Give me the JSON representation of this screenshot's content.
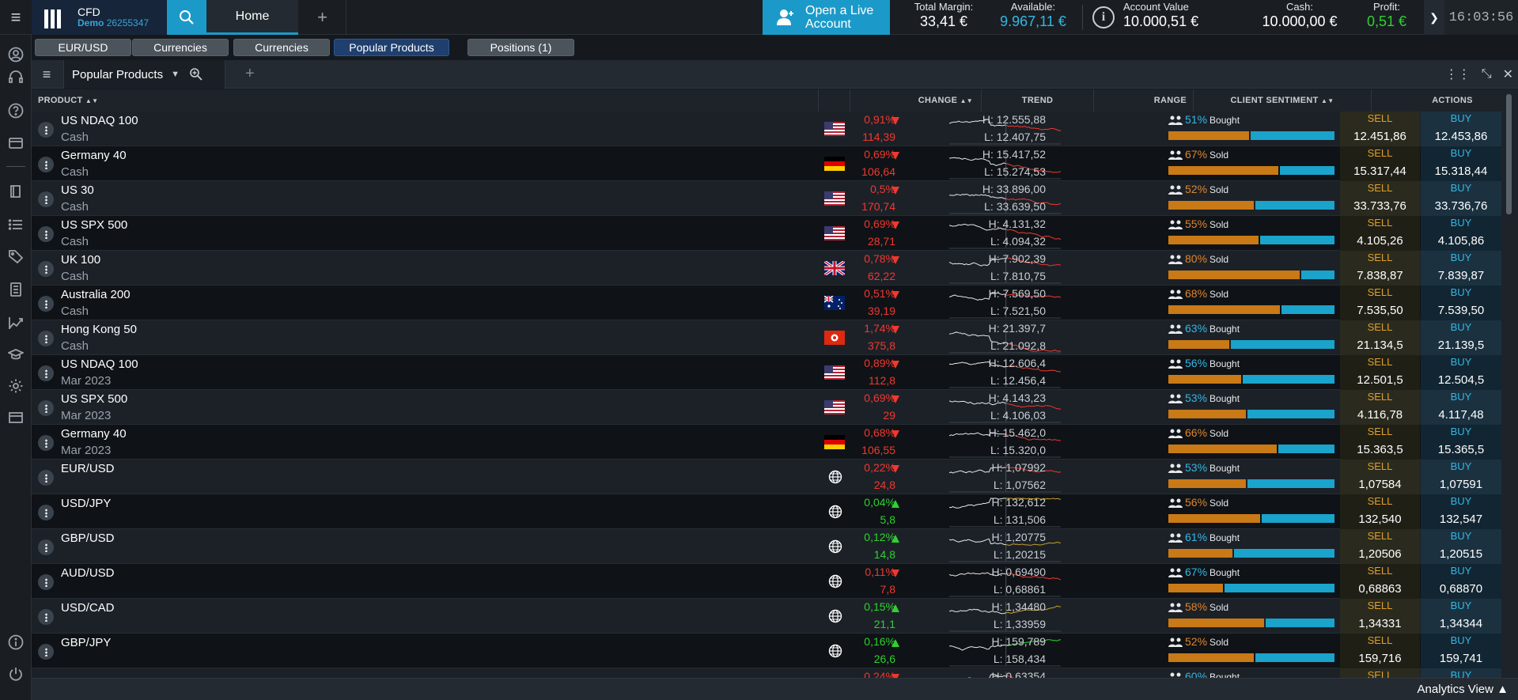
{
  "app": {
    "brand_title": "CFD",
    "brand_sub_prefix": "Demo",
    "brand_sub_account": "26255347",
    "home_tab": "Home",
    "add_tab": "+"
  },
  "header": {
    "live_account_line1": "Open a Live",
    "live_account_line2": "Account",
    "total_margin_label": "Total Margin:",
    "total_margin_value": "33,41 €",
    "available_label": "Available:",
    "available_value": "9.967,11 €",
    "account_value_label": "Account Value",
    "account_value_value": "10.000,51 €",
    "cash_label": "Cash:",
    "cash_value": "10.000,00 €",
    "profit_label": "Profit:",
    "profit_value": "0,51 €",
    "clock": "16:03:56"
  },
  "workspace_tabs": [
    {
      "label": "EUR/USD",
      "active": false
    },
    {
      "label": "Currencies",
      "active": false
    },
    {
      "label": "Currencies",
      "active": false
    },
    {
      "label": "Popular Products",
      "active": true
    },
    {
      "label": "Positions (1)",
      "active": false
    }
  ],
  "panel": {
    "title": "Popular Products"
  },
  "table": {
    "columns": {
      "product": "PRODUCT",
      "change": "CHANGE",
      "trend": "TREND",
      "range": "RANGE",
      "sentiment": "CLIENT SENTIMENT",
      "actions": "ACTIONS"
    },
    "sell_label": "SELL",
    "buy_label": "BUY",
    "rows": [
      {
        "name": "US NDAQ 100",
        "sub": "Cash",
        "flag": "us",
        "dir": "down",
        "pct": "0,91%",
        "abs": "114,39",
        "high": "H: 12.555,88",
        "low": "L: 12.407,75",
        "sent_pct": "51%",
        "sent_label": "Bought",
        "sold_share": 49,
        "sell": "12.451,86",
        "buy": "12.453,86",
        "trend_color": "red"
      },
      {
        "name": "Germany 40",
        "sub": "Cash",
        "flag": "de",
        "dir": "down",
        "pct": "0,69%",
        "abs": "106,64",
        "high": "H: 15.417,52",
        "low": "L: 15.274,53",
        "sent_pct": "67%",
        "sent_label": "Sold",
        "sold_share": 67,
        "sell": "15.317,44",
        "buy": "15.318,44",
        "trend_color": "red"
      },
      {
        "name": "US 30",
        "sub": "Cash",
        "flag": "us",
        "dir": "down",
        "pct": "0,5%",
        "abs": "170,74",
        "high": "H: 33.896,00",
        "low": "L: 33.639,50",
        "sent_pct": "52%",
        "sent_label": "Sold",
        "sold_share": 52,
        "sell": "33.733,76",
        "buy": "33.736,76",
        "trend_color": "red"
      },
      {
        "name": "US SPX 500",
        "sub": "Cash",
        "flag": "us",
        "dir": "down",
        "pct": "0,69%",
        "abs": "28,71",
        "high": "H: 4.131,32",
        "low": "L: 4.094,32",
        "sent_pct": "55%",
        "sent_label": "Sold",
        "sold_share": 55,
        "sell": "4.105,26",
        "buy": "4.105,86",
        "trend_color": "red"
      },
      {
        "name": "UK 100",
        "sub": "Cash",
        "flag": "gb",
        "dir": "down",
        "pct": "0,78%",
        "abs": "62,22",
        "high": "H: 7.902,39",
        "low": "L: 7.810,75",
        "sent_pct": "80%",
        "sent_label": "Sold",
        "sold_share": 80,
        "sell": "7.838,87",
        "buy": "7.839,87",
        "trend_color": "red"
      },
      {
        "name": "Australia 200",
        "sub": "Cash",
        "flag": "au",
        "dir": "down",
        "pct": "0,51%",
        "abs": "39,19",
        "high": "H: 7.569,50",
        "low": "L: 7.521,50",
        "sent_pct": "68%",
        "sent_label": "Sold",
        "sold_share": 68,
        "sell": "7.535,50",
        "buy": "7.539,50",
        "trend_color": "red"
      },
      {
        "name": "Hong Kong 50",
        "sub": "Cash",
        "flag": "hk",
        "dir": "down",
        "pct": "1,74%",
        "abs": "375,8",
        "high": "H: 21.397,7",
        "low": "L: 21.092,8",
        "sent_pct": "63%",
        "sent_label": "Bought",
        "sold_share": 37,
        "sell": "21.134,5",
        "buy": "21.139,5",
        "trend_color": "red"
      },
      {
        "name": "US NDAQ 100",
        "sub": "Mar 2023",
        "flag": "us",
        "dir": "down",
        "pct": "0,89%",
        "abs": "112,8",
        "high": "H: 12.606,4",
        "low": "L: 12.456,4",
        "sent_pct": "56%",
        "sent_label": "Bought",
        "sold_share": 44,
        "sell": "12.501,5",
        "buy": "12.504,5",
        "trend_color": "red"
      },
      {
        "name": "US SPX 500",
        "sub": "Mar 2023",
        "flag": "us",
        "dir": "down",
        "pct": "0,69%",
        "abs": "29",
        "high": "H: 4.143,23",
        "low": "L: 4.106,03",
        "sent_pct": "53%",
        "sent_label": "Bought",
        "sold_share": 47,
        "sell": "4.116,78",
        "buy": "4.117,48",
        "trend_color": "red"
      },
      {
        "name": "Germany 40",
        "sub": "Mar 2023",
        "flag": "de",
        "dir": "down",
        "pct": "0,68%",
        "abs": "106,55",
        "high": "H: 15.462,0",
        "low": "L: 15.320,0",
        "sent_pct": "66%",
        "sent_label": "Sold",
        "sold_share": 66,
        "sell": "15.363,5",
        "buy": "15.365,5",
        "trend_color": "red"
      },
      {
        "name": "EUR/USD",
        "sub": "",
        "flag": "globe",
        "dir": "down",
        "pct": "0,22%",
        "abs": "24,8",
        "high": "H: 1,07992",
        "low": "L: 1,07562",
        "sent_pct": "53%",
        "sent_label": "Bought",
        "sold_share": 47,
        "sell": "1,07584",
        "buy": "1,07591",
        "trend_color": "red"
      },
      {
        "name": "USD/JPY",
        "sub": "",
        "flag": "globe",
        "dir": "up",
        "pct": "0,04%",
        "abs": "5,8",
        "high": "H: 132,612",
        "low": "L: 131,506",
        "sent_pct": "56%",
        "sent_label": "Sold",
        "sold_share": 56,
        "sell": "132,540",
        "buy": "132,547",
        "trend_color": "mixed"
      },
      {
        "name": "GBP/USD",
        "sub": "",
        "flag": "globe",
        "dir": "up",
        "pct": "0,12%",
        "abs": "14,8",
        "high": "H: 1,20775",
        "low": "L: 1,20215",
        "sent_pct": "61%",
        "sent_label": "Bought",
        "sold_share": 39,
        "sell": "1,20506",
        "buy": "1,20515",
        "trend_color": "mixed"
      },
      {
        "name": "AUD/USD",
        "sub": "",
        "flag": "globe",
        "dir": "down",
        "pct": "0,11%",
        "abs": "7,8",
        "high": "H: 0,69490",
        "low": "L: 0,68861",
        "sent_pct": "67%",
        "sent_label": "Bought",
        "sold_share": 33,
        "sell": "0,68863",
        "buy": "0,68870",
        "trend_color": "red"
      },
      {
        "name": "USD/CAD",
        "sub": "",
        "flag": "globe",
        "dir": "up",
        "pct": "0,15%",
        "abs": "21,1",
        "high": "H: 1,34480",
        "low": "L: 1,33959",
        "sent_pct": "58%",
        "sent_label": "Sold",
        "sold_share": 58,
        "sell": "1,34331",
        "buy": "1,34344",
        "trend_color": "mixed"
      },
      {
        "name": "GBP/JPY",
        "sub": "",
        "flag": "globe",
        "dir": "up",
        "pct": "0,16%",
        "abs": "26,6",
        "high": "H: 159,789",
        "low": "L: 158,434",
        "sent_pct": "52%",
        "sent_label": "Sold",
        "sold_share": 52,
        "sell": "159,716",
        "buy": "159,741",
        "trend_color": "green"
      },
      {
        "name": "",
        "sub": "",
        "flag": "globe",
        "dir": "down",
        "pct": "0,24%",
        "abs": "",
        "high": "H: 0,63354",
        "low": "",
        "sent_pct": "60%",
        "sent_label": "Bought",
        "sold_share": 40,
        "sell": "",
        "buy": "",
        "trend_color": "red"
      }
    ]
  },
  "footer": {
    "analytics_label": "Analytics View ▲"
  },
  "colors": {
    "accent": "#1b9ac9",
    "up": "#2fd12f",
    "down": "#f0382e",
    "sold": "#c97916",
    "bought": "#1aa3cb"
  }
}
